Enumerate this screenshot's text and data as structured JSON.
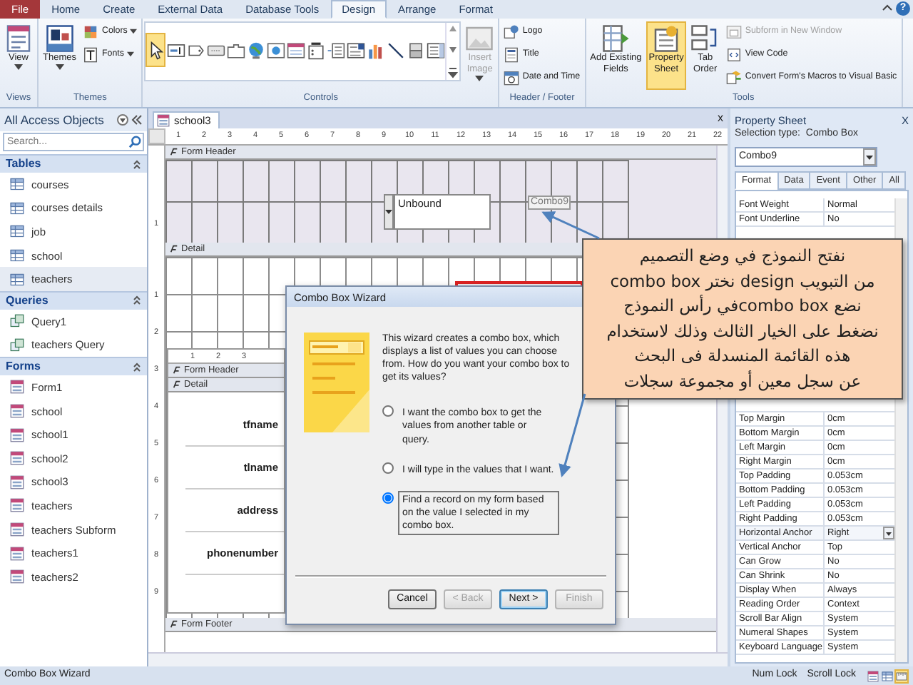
{
  "ribbon": {
    "tabs": [
      {
        "label": "File",
        "kind": "file",
        "selected": false
      },
      {
        "label": "Home",
        "kind": "tab",
        "selected": false
      },
      {
        "label": "Create",
        "kind": "tab",
        "selected": false
      },
      {
        "label": "External Data",
        "kind": "tab",
        "selected": false
      },
      {
        "label": "Database Tools",
        "kind": "tab",
        "selected": false
      },
      {
        "label": "Design",
        "kind": "tab",
        "selected": true
      },
      {
        "label": "Arrange",
        "kind": "tab",
        "selected": false
      },
      {
        "label": "Format",
        "kind": "tab",
        "selected": false
      }
    ],
    "help": "?",
    "groups": [
      {
        "label": "Views",
        "items": [
          {
            "kind": "large",
            "label": "View",
            "caret": true,
            "selected": false,
            "disabled": false
          }
        ]
      },
      {
        "label": "Themes",
        "items": [
          {
            "kind": "large",
            "label": "Themes",
            "caret": true,
            "selected": false,
            "disabled": false
          },
          {
            "kind": "small",
            "label": "Colors",
            "caret": true,
            "selected": false,
            "disabled": false
          },
          {
            "kind": "small",
            "label": "Fonts",
            "caret": true,
            "selected": false,
            "disabled": false
          }
        ]
      },
      {
        "label": "Controls",
        "items": [
          {
            "kind": "gallery",
            "tools": [
              {
                "selected": true
              },
              {
                "selected": false
              },
              {
                "selected": false
              },
              {
                "selected": false
              },
              {
                "selected": false
              },
              {
                "selected": false
              },
              {
                "selected": false
              },
              {
                "selected": false
              },
              {
                "selected": false
              },
              {
                "selected": false
              },
              {
                "selected": false
              },
              {
                "selected": false
              },
              {
                "selected": false
              },
              {
                "selected": false
              },
              {
                "selected": false
              }
            ]
          },
          {
            "kind": "large",
            "label": "Insert\nImage",
            "caret": true,
            "selected": false,
            "disabled": true
          }
        ]
      },
      {
        "label": "Header / Footer",
        "items": [
          {
            "kind": "small",
            "label": "Logo",
            "caret": false,
            "selected": false,
            "disabled": false
          },
          {
            "kind": "small",
            "label": "Title",
            "caret": false,
            "selected": false,
            "disabled": false
          },
          {
            "kind": "small",
            "label": "Date and Time",
            "caret": false,
            "selected": false,
            "disabled": false
          }
        ]
      },
      {
        "label": "Tools",
        "items": [
          {
            "kind": "large",
            "label": "Add Existing\nFields",
            "caret": false,
            "selected": false,
            "disabled": false
          },
          {
            "kind": "large",
            "label": "Property\nSheet",
            "caret": false,
            "selected": true,
            "disabled": false
          },
          {
            "kind": "large",
            "label": "Tab\nOrder",
            "caret": false,
            "selected": false,
            "disabled": false
          },
          {
            "kind": "small",
            "label": "Subform in New Window",
            "caret": false,
            "selected": false,
            "disabled": true
          },
          {
            "kind": "small",
            "label": "View Code",
            "caret": false,
            "selected": false,
            "disabled": false
          },
          {
            "kind": "small",
            "label": "Convert Form's Macros to Visual Basic",
            "caret": false,
            "selected": false,
            "disabled": false
          }
        ]
      }
    ]
  },
  "navigation_pane": {
    "title": "All Access Objects",
    "search": {
      "placeholder": "Search..."
    },
    "groups": [
      {
        "label": "Tables",
        "kind": "table",
        "items": [
          {
            "label": "courses",
            "selected": false
          },
          {
            "label": "courses details",
            "selected": false
          },
          {
            "label": "job",
            "selected": false
          },
          {
            "label": "school",
            "selected": false
          },
          {
            "label": "teachers",
            "selected": true
          }
        ]
      },
      {
        "label": "Queries",
        "kind": "query",
        "items": [
          {
            "label": "Query1",
            "selected": false
          },
          {
            "label": "teachers Query",
            "selected": false
          }
        ]
      },
      {
        "label": "Forms",
        "kind": "form",
        "items": [
          {
            "label": "Form1",
            "selected": false
          },
          {
            "label": "school",
            "selected": false
          },
          {
            "label": "school1",
            "selected": false
          },
          {
            "label": "school2",
            "selected": false
          },
          {
            "label": "school3",
            "selected": false
          },
          {
            "label": "teachers",
            "selected": false
          },
          {
            "label": "teachers Subform",
            "selected": false
          },
          {
            "label": "teachers1",
            "selected": false
          },
          {
            "label": "teachers2",
            "selected": false
          }
        ]
      }
    ]
  },
  "document": {
    "tab": "school3",
    "close": "x",
    "ruler": [
      "1",
      "2",
      "3",
      "4",
      "5",
      "6",
      "7",
      "8",
      "9",
      "10",
      "11",
      "12",
      "13",
      "14",
      "15",
      "16",
      "17",
      "18",
      "19",
      "20",
      "21",
      "22"
    ],
    "vertical_ruler": {
      "header": [
        "1"
      ],
      "detail": [
        "1",
        "2",
        "3",
        "4",
        "5",
        "6",
        "7",
        "8",
        "9"
      ]
    },
    "sections": {
      "header": "Form Header",
      "detail": "Detail",
      "footer": "Form Footer"
    },
    "header_controls": {
      "combo_box": "Unbound",
      "label": "Combo9"
    },
    "subform": {
      "ruler": [
        "1",
        "2",
        "3"
      ],
      "header": "Form Header",
      "detail": "Detail",
      "labels": [
        "tfname",
        "tlname",
        "address",
        "phonenumber"
      ]
    }
  },
  "wizard": {
    "title": "Combo Box Wizard",
    "description": "This wizard creates a combo box, which displays a list of values you can choose from.  How do you want your combo box to get its values?",
    "options": [
      {
        "label": "I want the combo box to get the values from another table or query.",
        "selected": false
      },
      {
        "label": "I will type in the values that I want.",
        "selected": false
      },
      {
        "label": "Find a record on my form based on the value I selected in my combo box.",
        "selected": true
      }
    ],
    "buttons": [
      {
        "label": "Cancel",
        "disabled": false,
        "default": false
      },
      {
        "label": "< Back",
        "disabled": true,
        "default": false
      },
      {
        "label": "Next >",
        "disabled": false,
        "default": true
      },
      {
        "label": "Finish",
        "disabled": true,
        "default": false
      }
    ]
  },
  "callout": {
    "text": "نفتح النموذج في وضع التصميم\nمن التبويب design نختر combo box\nنضع combo boxفي رأس النموذج\nنضغط على الخيار الثالث وذلك لاستخدام\nهذه القائمة المنسدلة فى البحث\nعن سجل معين أو مجموعة سجلات"
  },
  "property_sheet": {
    "title": "Property Sheet",
    "close": "X",
    "selection_type_label": "Selection type:",
    "selection_type": "Combo Box",
    "object": "Combo9",
    "tabs": [
      {
        "label": "Format",
        "selected": true
      },
      {
        "label": "Data",
        "selected": false
      },
      {
        "label": "Event",
        "selected": false
      },
      {
        "label": "Other",
        "selected": false
      },
      {
        "label": "All",
        "selected": false
      }
    ],
    "rows_above": [
      {
        "name": "Font Weight",
        "value": "Normal",
        "selected": false
      },
      {
        "name": "Font Underline",
        "value": "No",
        "selected": false
      }
    ],
    "rows_below": [
      {
        "name": "Top Margin",
        "value": "0cm",
        "selected": false
      },
      {
        "name": "Bottom Margin",
        "value": "0cm",
        "selected": false
      },
      {
        "name": "Left Margin",
        "value": "0cm",
        "selected": false
      },
      {
        "name": "Right Margin",
        "value": "0cm",
        "selected": false
      },
      {
        "name": "Top Padding",
        "value": "0.053cm",
        "selected": false
      },
      {
        "name": "Bottom Padding",
        "value": "0.053cm",
        "selected": false
      },
      {
        "name": "Left Padding",
        "value": "0.053cm",
        "selected": false
      },
      {
        "name": "Right Padding",
        "value": "0.053cm",
        "selected": false
      },
      {
        "name": "Horizontal Anchor",
        "value": "Right",
        "selected": true
      },
      {
        "name": "Vertical Anchor",
        "value": "Top",
        "selected": false
      },
      {
        "name": "Can Grow",
        "value": "No",
        "selected": false
      },
      {
        "name": "Can Shrink",
        "value": "No",
        "selected": false
      },
      {
        "name": "Display When",
        "value": "Always",
        "selected": false
      },
      {
        "name": "Reading Order",
        "value": "Context",
        "selected": false
      },
      {
        "name": "Scroll Bar Align",
        "value": "System",
        "selected": false
      },
      {
        "name": "Numeral Shapes",
        "value": "System",
        "selected": false
      },
      {
        "name": "Keyboard Language",
        "value": "System",
        "selected": false
      }
    ]
  },
  "status_bar": {
    "text": "Combo Box Wizard",
    "indicators": [
      "Num Lock",
      "Scroll Lock"
    ],
    "views": [
      {
        "selected": false
      },
      {
        "selected": false
      },
      {
        "selected": true
      }
    ]
  }
}
